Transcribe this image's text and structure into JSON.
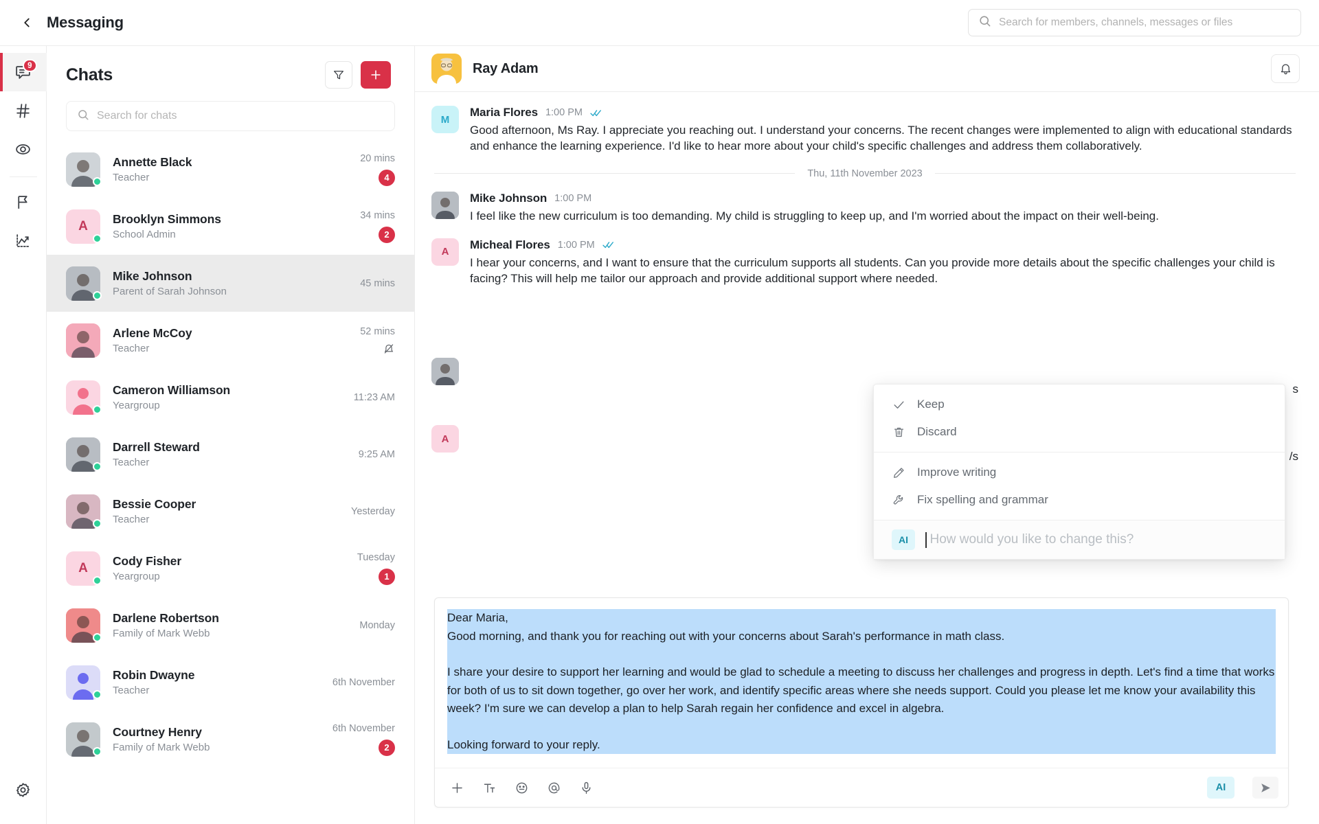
{
  "topbar": {
    "back_icon": "chevron-left-icon",
    "title": "Messaging",
    "search": {
      "icon": "search-icon",
      "placeholder": "Search for members, channels, messages or files",
      "value": ""
    }
  },
  "rail": {
    "items": [
      {
        "icon": "messages-icon",
        "badge": "9",
        "active": true
      },
      {
        "icon": "hashtag-icon",
        "badge": "",
        "active": false
      },
      {
        "icon": "eye-icon",
        "badge": "",
        "active": false
      },
      {
        "icon": "flag-icon",
        "badge": "",
        "active": false
      },
      {
        "icon": "analytics-icon",
        "badge": "",
        "active": false
      }
    ],
    "settings_icon": "gear-icon"
  },
  "chatlist": {
    "title": "Chats",
    "filter_icon": "filter-icon",
    "add_icon": "plus-icon",
    "search": {
      "icon": "search-icon",
      "placeholder": "Search for chats",
      "value": ""
    },
    "items": [
      {
        "name": "Annette Black",
        "role": "Teacher",
        "time": "20 mins",
        "unread": "4",
        "online": true,
        "muted": false,
        "avatar_type": "photo",
        "avatar_bg": "#cfd4d8",
        "avatar_text": ""
      },
      {
        "name": "Brooklyn Simmons",
        "role": "School Admin",
        "time": "34 mins",
        "unread": "2",
        "online": true,
        "muted": false,
        "avatar_type": "initial",
        "avatar_bg": "#fbd6e2",
        "avatar_text": "A"
      },
      {
        "name": "Mike Johnson",
        "role": "Parent of Sarah Johnson",
        "time": "45 mins",
        "unread": "",
        "online": true,
        "muted": false,
        "avatar_type": "photo",
        "avatar_bg": "#b7bcc2",
        "avatar_text": ""
      },
      {
        "name": "Arlene McCoy",
        "role": "Teacher",
        "time": "52 mins",
        "unread": "",
        "online": false,
        "muted": true,
        "avatar_type": "photo",
        "avatar_bg": "#f4a9b9",
        "avatar_text": ""
      },
      {
        "name": "Cameron Williamson",
        "role": "Yeargroup",
        "time": "11:23 AM",
        "unread": "",
        "online": true,
        "muted": false,
        "avatar_type": "person",
        "avatar_bg": "#fbd6e2",
        "avatar_text": ""
      },
      {
        "name": "Darrell Steward",
        "role": "Teacher",
        "time": "9:25 AM",
        "unread": "",
        "online": true,
        "muted": false,
        "avatar_type": "photo",
        "avatar_bg": "#b8bdc3",
        "avatar_text": ""
      },
      {
        "name": "Bessie Cooper",
        "role": "Teacher",
        "time": "Yesterday",
        "unread": "",
        "online": true,
        "muted": false,
        "avatar_type": "photo",
        "avatar_bg": "#d8b7c2",
        "avatar_text": ""
      },
      {
        "name": "Cody Fisher",
        "role": "Yeargroup",
        "time": "Tuesday",
        "unread": "1",
        "online": true,
        "muted": false,
        "avatar_type": "initial",
        "avatar_bg": "#fbd6e2",
        "avatar_text": "A"
      },
      {
        "name": "Darlene Robertson",
        "role": "Family of Mark Webb",
        "time": "Monday",
        "unread": "",
        "online": true,
        "muted": false,
        "avatar_type": "photo",
        "avatar_bg": "#ef8a8a",
        "avatar_text": ""
      },
      {
        "name": "Robin Dwayne",
        "role": "Teacher",
        "time": "6th November",
        "unread": "",
        "online": true,
        "muted": false,
        "avatar_type": "person",
        "avatar_bg": "#dcdcf8",
        "avatar_text": ""
      },
      {
        "name": "Courtney Henry",
        "role": "Family of Mark Webb",
        "time": "6th November",
        "unread": "2",
        "online": true,
        "muted": false,
        "avatar_type": "photo",
        "avatar_bg": "#c3c9cc",
        "avatar_text": ""
      }
    ]
  },
  "conversation": {
    "header": {
      "name": "Ray Adam",
      "avatar_bg": "#f7c13f",
      "bell_icon": "bell-icon"
    },
    "messages": [
      {
        "author": "Maria Flores",
        "time": "1:00 PM",
        "read": true,
        "avatar_type": "initial",
        "avatar_bg": "#c9f3f8",
        "avatar_text": "M",
        "avatar_color": "#2aa9c9",
        "text": "Good afternoon, Ms Ray. I appreciate you reaching out. I understand your concerns. The recent changes were implemented to align with educational standards and enhance the learning experience. I'd like to hear more about your child's specific challenges and address them collaboratively."
      },
      {
        "author": "Mike Johnson",
        "time": "1:00 PM",
        "read": false,
        "avatar_type": "photo",
        "avatar_bg": "#b7bcc2",
        "avatar_text": "",
        "avatar_color": "#444",
        "text": "I feel like the new curriculum is too demanding. My child is struggling to keep up, and I'm worried about the impact on their well-being."
      },
      {
        "author": "Micheal Flores",
        "time": "1:00 PM",
        "read": true,
        "avatar_type": "initial",
        "avatar_bg": "#fbd6e2",
        "avatar_text": "A",
        "avatar_color": "#c2395a",
        "text": "I hear your concerns, and I want to ensure that the curriculum supports all students. Can you provide more details about the specific challenges your child is facing? This will help me tailor our approach and provide additional support where needed."
      }
    ],
    "date_divider": "Thu, 11th November 2023",
    "occluded_fragments": [
      "s",
      "/s"
    ]
  },
  "ai_popup": {
    "groups": [
      {
        "items": [
          {
            "icon": "check-icon",
            "label": "Keep"
          },
          {
            "icon": "trash-icon",
            "label": "Discard"
          }
        ]
      },
      {
        "items": [
          {
            "icon": "pencil-icon",
            "label": "Improve writing"
          },
          {
            "icon": "wrench-icon",
            "label": "Fix spelling and grammar"
          }
        ]
      }
    ],
    "prompt": {
      "chip": "AI",
      "placeholder": "How would you like to change this?",
      "value": ""
    }
  },
  "composer": {
    "draft_lines": [
      "Dear Maria,",
      "Good morning, and thank you for reaching out with your concerns about Sarah's performance in math class.",
      "",
      "I share your desire to support her learning and would be glad to schedule a meeting to discuss her challenges and progress in depth. Let's find a time that works for both of us to sit down together, go over her work, and identify specific areas where she needs support. Could you please let me know your availability this week? I'm sure we can develop a plan to help Sarah regain her confidence and excel in algebra.",
      "",
      "Looking forward to your reply."
    ],
    "tools": [
      {
        "icon": "plus-icon",
        "label": "Attach"
      },
      {
        "icon": "text-format-icon",
        "label": "Format text"
      },
      {
        "icon": "emoji-icon",
        "label": "Emoji"
      },
      {
        "icon": "mention-icon",
        "label": "Mention"
      },
      {
        "icon": "microphone-icon",
        "label": "Voice message"
      }
    ],
    "ai_label": "AI",
    "send_icon": "send-icon"
  },
  "colors": {
    "accent_red": "#d93148",
    "presence_green": "#2ed198",
    "ai_cyan": "#1a8fa8",
    "ai_cyan_bg": "#dff6fb",
    "draft_highlight": "#bcddfb"
  }
}
